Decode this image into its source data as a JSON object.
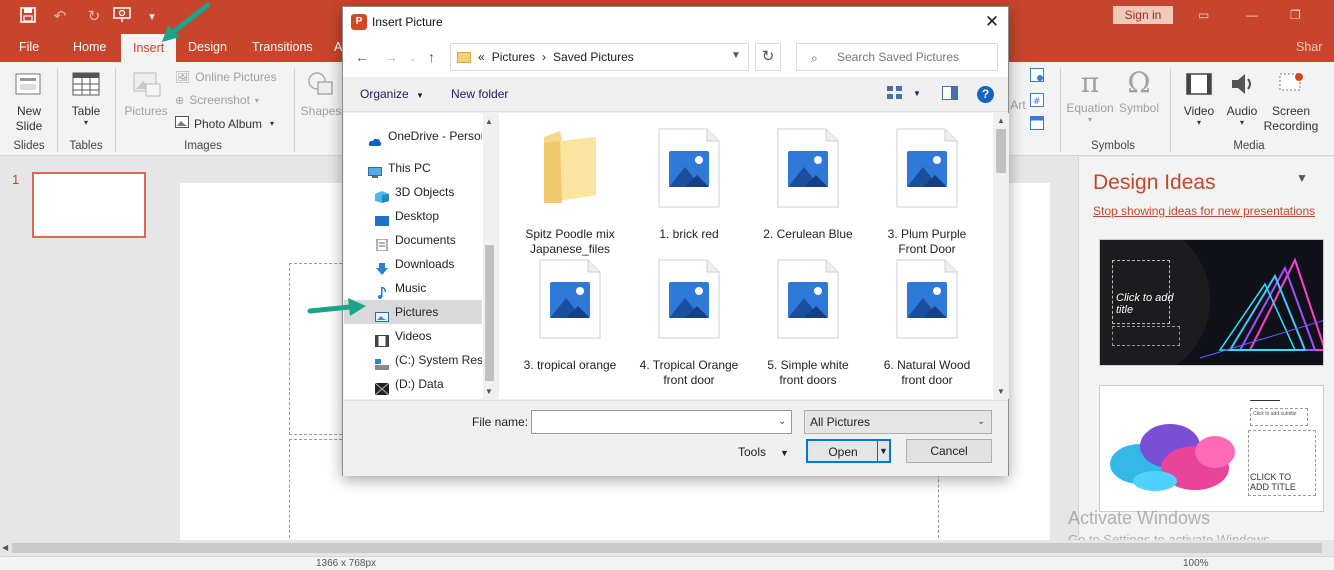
{
  "app": {
    "signin_label": "Sign in",
    "share_label": "Shar"
  },
  "ribbon_tabs": [
    "File",
    "Home",
    "Insert",
    "Design",
    "Transitions",
    "A"
  ],
  "ribbon": {
    "new_slide": "New Slide",
    "slides_group": "Slides",
    "table": "Table",
    "tables_group": "Tables",
    "pictures": "Pictures",
    "online_pictures": "Online Pictures",
    "screenshot": "Screenshot",
    "photo_album": "Photo Album",
    "images_group": "Images",
    "shapes": "Shapes",
    "art_fragment": "Art",
    "equation": "Equation",
    "symbol": "Symbol",
    "symbols_group": "Symbols",
    "video": "Video",
    "audio": "Audio",
    "screen_recording": "Screen Recording",
    "media_group": "Media"
  },
  "slides_pane": {
    "slide_number": "1"
  },
  "design_ideas": {
    "title": "Design Ideas",
    "stop_link": "Stop showing ideas for new presentations",
    "idea1_title": "Click to add title",
    "idea2_title": "CLICK TO ADD TITLE",
    "idea2_subtitle": "Click to add subtitle"
  },
  "watermark": {
    "line1": "Activate Windows",
    "line2": "Go to Settings to activate Windows."
  },
  "statusbar": {
    "size_text": "1366 x 768px",
    "zoom": "100%"
  },
  "dialog": {
    "title": "Insert Picture",
    "breadcrumb": [
      "«",
      "Pictures",
      "›",
      "Saved Pictures"
    ],
    "search_placeholder": "Search Saved Pictures",
    "organize": "Organize",
    "new_folder": "New folder",
    "help": "?",
    "nav_items": [
      {
        "label": "OneDrive - Person",
        "icon": "onedrive-icon"
      },
      {
        "label": "This PC",
        "icon": "this-pc-icon"
      },
      {
        "label": "3D Objects",
        "icon": "3d-objects-icon"
      },
      {
        "label": "Desktop",
        "icon": "desktop-icon"
      },
      {
        "label": "Documents",
        "icon": "documents-icon"
      },
      {
        "label": "Downloads",
        "icon": "downloads-icon"
      },
      {
        "label": "Music",
        "icon": "music-icon"
      },
      {
        "label": "Pictures",
        "icon": "pictures-icon"
      },
      {
        "label": "Videos",
        "icon": "videos-icon"
      },
      {
        "label": "(C:) System Rese",
        "icon": "drive-c-icon"
      },
      {
        "label": "(D:) Data",
        "icon": "drive-d-icon"
      }
    ],
    "files": [
      {
        "label": "Spitz Poodle mix Japanese_files",
        "type": "folder"
      },
      {
        "label": "1. brick red",
        "type": "image"
      },
      {
        "label": "2. Cerulean Blue",
        "type": "image"
      },
      {
        "label": "3. Plum Purple Front Door",
        "type": "image"
      },
      {
        "label": "3. tropical orange",
        "type": "image"
      },
      {
        "label": "4. Tropical Orange front door",
        "type": "image"
      },
      {
        "label": "5. Simple white front doors",
        "type": "image"
      },
      {
        "label": "6. Natural Wood front door",
        "type": "image"
      }
    ],
    "file_name_label": "File name:",
    "file_name_value": "",
    "file_type": "All Pictures",
    "tools": "Tools",
    "open": "Open",
    "cancel": "Cancel"
  },
  "colors": {
    "accent": "#c6452c",
    "annotation_arrow": "#1aa58a",
    "selection": "#0078d7"
  }
}
